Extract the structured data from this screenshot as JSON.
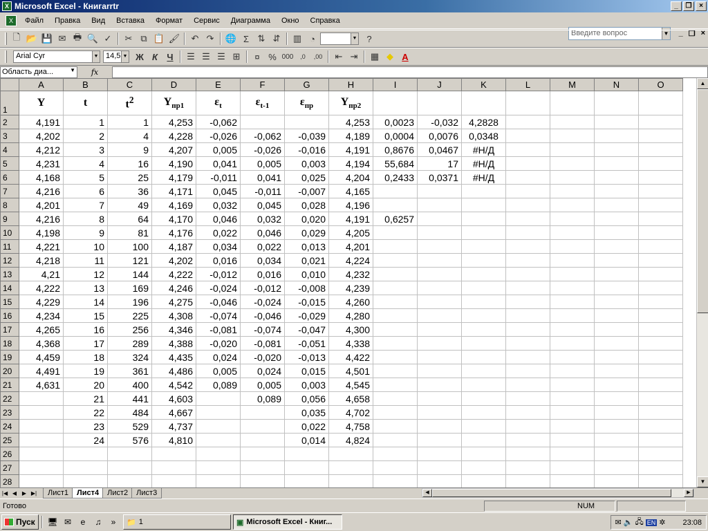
{
  "window": {
    "title": "Microsoft Excel - Книгаrrtr"
  },
  "menu": [
    "Файл",
    "Правка",
    "Вид",
    "Вставка",
    "Формат",
    "Сервис",
    "Диаграмма",
    "Окно",
    "Справка"
  ],
  "help_placeholder": "Введите вопрос",
  "format_toolbar": {
    "font": "Arial Cyr",
    "size": "14,5",
    "bold": "Ж",
    "italic": "К",
    "underline": "Ч"
  },
  "formula_bar": {
    "name_box": "Область диа...",
    "fx": "fx"
  },
  "columns": [
    "A",
    "B",
    "C",
    "D",
    "E",
    "F",
    "G",
    "H",
    "I",
    "J",
    "K",
    "L",
    "M",
    "N",
    "O"
  ],
  "header_row": {
    "A": "Y",
    "B": "t",
    "C": "t",
    "C_sup": "2",
    "D": "Y",
    "D_sub": "пр1",
    "E": "ε",
    "E_sub": "t",
    "F": "ε",
    "F_sub": "t-1",
    "G": "ε",
    "G_sub": "пр",
    "H": "Y",
    "H_sub": "пр2"
  },
  "rows": [
    [
      "4,191",
      "1",
      "1",
      "4,253",
      "-0,062",
      "",
      "",
      "4,253",
      "0,0023",
      "-0,032",
      "4,2828"
    ],
    [
      "4,202",
      "2",
      "4",
      "4,228",
      "-0,026",
      "-0,062",
      "-0,039",
      "4,189",
      "0,0004",
      "0,0076",
      "0,0348"
    ],
    [
      "4,212",
      "3",
      "9",
      "4,207",
      "0,005",
      "-0,026",
      "-0,016",
      "4,191",
      "0,8676",
      "0,0467",
      "#Н/Д"
    ],
    [
      "4,231",
      "4",
      "16",
      "4,190",
      "0,041",
      "0,005",
      "0,003",
      "4,194",
      "55,684",
      "17",
      "#Н/Д"
    ],
    [
      "4,168",
      "5",
      "25",
      "4,179",
      "-0,011",
      "0,041",
      "0,025",
      "4,204",
      "0,2433",
      "0,0371",
      "#Н/Д"
    ],
    [
      "4,216",
      "6",
      "36",
      "4,171",
      "0,045",
      "-0,011",
      "-0,007",
      "4,165",
      "",
      "",
      ""
    ],
    [
      "4,201",
      "7",
      "49",
      "4,169",
      "0,032",
      "0,045",
      "0,028",
      "4,196",
      "",
      "",
      ""
    ],
    [
      "4,216",
      "8",
      "64",
      "4,170",
      "0,046",
      "0,032",
      "0,020",
      "4,191",
      "0,6257",
      "",
      ""
    ],
    [
      "4,198",
      "9",
      "81",
      "4,176",
      "0,022",
      "0,046",
      "0,029",
      "4,205",
      "",
      "",
      ""
    ],
    [
      "4,221",
      "10",
      "100",
      "4,187",
      "0,034",
      "0,022",
      "0,013",
      "4,201",
      "",
      "",
      ""
    ],
    [
      "4,218",
      "11",
      "121",
      "4,202",
      "0,016",
      "0,034",
      "0,021",
      "4,224",
      "",
      "",
      ""
    ],
    [
      "4,21",
      "12",
      "144",
      "4,222",
      "-0,012",
      "0,016",
      "0,010",
      "4,232",
      "",
      "",
      ""
    ],
    [
      "4,222",
      "13",
      "169",
      "4,246",
      "-0,024",
      "-0,012",
      "-0,008",
      "4,239",
      "",
      "",
      ""
    ],
    [
      "4,229",
      "14",
      "196",
      "4,275",
      "-0,046",
      "-0,024",
      "-0,015",
      "4,260",
      "",
      "",
      ""
    ],
    [
      "4,234",
      "15",
      "225",
      "4,308",
      "-0,074",
      "-0,046",
      "-0,029",
      "4,280",
      "",
      "",
      ""
    ],
    [
      "4,265",
      "16",
      "256",
      "4,346",
      "-0,081",
      "-0,074",
      "-0,047",
      "4,300",
      "",
      "",
      ""
    ],
    [
      "4,368",
      "17",
      "289",
      "4,388",
      "-0,020",
      "-0,081",
      "-0,051",
      "4,338",
      "",
      "",
      ""
    ],
    [
      "4,459",
      "18",
      "324",
      "4,435",
      "0,024",
      "-0,020",
      "-0,013",
      "4,422",
      "",
      "",
      ""
    ],
    [
      "4,491",
      "19",
      "361",
      "4,486",
      "0,005",
      "0,024",
      "0,015",
      "4,501",
      "",
      "",
      ""
    ],
    [
      "4,631",
      "20",
      "400",
      "4,542",
      "0,089",
      "0,005",
      "0,003",
      "4,545",
      "",
      "",
      ""
    ],
    [
      "",
      "21",
      "441",
      "4,603",
      "",
      "0,089",
      "0,056",
      "4,658",
      "",
      "",
      ""
    ],
    [
      "",
      "22",
      "484",
      "4,667",
      "",
      "",
      "0,035",
      "4,702",
      "",
      "",
      ""
    ],
    [
      "",
      "23",
      "529",
      "4,737",
      "",
      "",
      "0,022",
      "4,758",
      "",
      "",
      ""
    ],
    [
      "",
      "24",
      "576",
      "4,810",
      "",
      "",
      "0,014",
      "4,824",
      "",
      "",
      ""
    ],
    [
      "",
      "",
      "",
      "",
      "",
      "",
      "",
      "",
      "",
      "",
      ""
    ],
    [
      "",
      "",
      "",
      "",
      "",
      "",
      "",
      "",
      "",
      "",
      ""
    ],
    [
      "",
      "",
      "",
      "",
      "",
      "",
      "",
      "",
      "",
      "",
      ""
    ],
    [
      "",
      "",
      "",
      "",
      "",
      "",
      "",
      "",
      "",
      "",
      ""
    ]
  ],
  "sheet_tabs": [
    "Лист1",
    "Лист4",
    "Лист2",
    "Лист3"
  ],
  "active_tab": "Лист4",
  "status": {
    "text": "Готово",
    "num": "NUM"
  },
  "taskbar": {
    "start": "Пуск",
    "folder": "1",
    "excel": "Microsoft Excel - Книг...",
    "time": "23:08",
    "lang": "EN"
  }
}
